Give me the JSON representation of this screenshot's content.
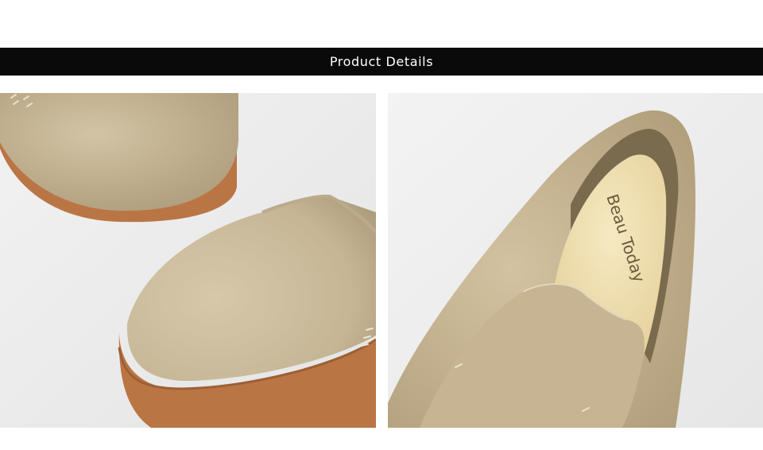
{
  "header": {
    "title": "Product Details"
  },
  "photos": [
    {
      "name": "suede-shoe-toe-closeup"
    },
    {
      "name": "suede-shoe-insole-closeup",
      "insole_brand": "Beau Today"
    }
  ],
  "colors": {
    "banner": "#0a0a0a",
    "suede": "#c9b99a",
    "sole": "#b8713e",
    "insole": "#f2e3b6"
  }
}
